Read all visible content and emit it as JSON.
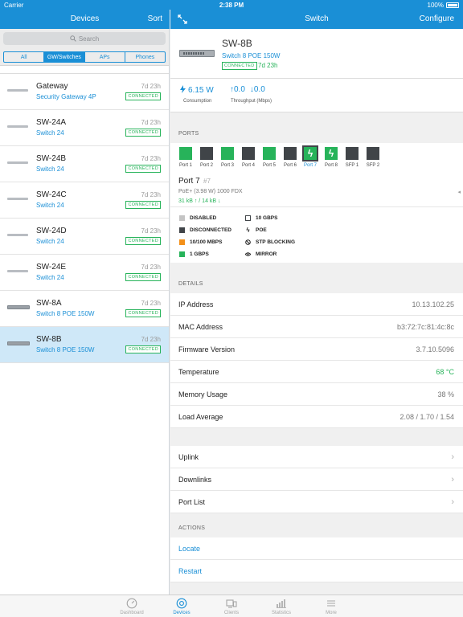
{
  "status": {
    "carrier": "Carrier",
    "time": "2:38 PM",
    "battery": "100%"
  },
  "left_nav": {
    "title": "Devices",
    "sort": "Sort"
  },
  "right_nav": {
    "title": "Switch",
    "configure": "Configure",
    "expand_icon": "expand-icon"
  },
  "search": {
    "placeholder": "Search"
  },
  "filters": [
    {
      "label": "All",
      "active": false
    },
    {
      "label": "GW/Switches",
      "active": true
    },
    {
      "label": "APs",
      "active": false
    },
    {
      "label": "Phones",
      "active": false
    }
  ],
  "devices": [
    {
      "name": "Gateway",
      "model": "Security Gateway 4P",
      "age": "7d 23h",
      "status": "CONNECTED"
    },
    {
      "name": "SW-24A",
      "model": "Switch 24",
      "age": "7d 23h",
      "status": "CONNECTED"
    },
    {
      "name": "SW-24B",
      "model": "Switch 24",
      "age": "7d 23h",
      "status": "CONNECTED"
    },
    {
      "name": "SW-24C",
      "model": "Switch 24",
      "age": "7d 23h",
      "status": "CONNECTED"
    },
    {
      "name": "SW-24D",
      "model": "Switch 24",
      "age": "7d 23h",
      "status": "CONNECTED"
    },
    {
      "name": "SW-24E",
      "model": "Switch 24",
      "age": "7d 23h",
      "status": "CONNECTED"
    },
    {
      "name": "SW-8A",
      "model": "Switch 8 POE 150W",
      "age": "7d 23h",
      "status": "CONNECTED"
    },
    {
      "name": "SW-8B",
      "model": "Switch 8 POE 150W",
      "age": "7d 23h",
      "status": "CONNECTED"
    }
  ],
  "detail": {
    "name": "SW-8B",
    "model": "Switch 8 POE 150W",
    "status": "CONNECTED",
    "age": "7d 23h",
    "consumption_value": "6.15 W",
    "consumption_label": "Consumption",
    "throughput_up": "0.0",
    "throughput_down": "0.0",
    "throughput_label": "Throughput (Mbps)"
  },
  "ports_section": {
    "title": "PORTS",
    "ports": [
      {
        "label": "Port 1",
        "state": "green"
      },
      {
        "label": "Port 2",
        "state": "dark"
      },
      {
        "label": "Port 3",
        "state": "green"
      },
      {
        "label": "Port 4",
        "state": "dark"
      },
      {
        "label": "Port 5",
        "state": "green"
      },
      {
        "label": "Port 6",
        "state": "dark"
      },
      {
        "label": "Port 7",
        "state": "poe",
        "selected": true
      },
      {
        "label": "Port 8",
        "state": "poe"
      },
      {
        "label": "SFP 1",
        "state": "dark"
      },
      {
        "label": "SFP 2",
        "state": "dark"
      }
    ],
    "selected": {
      "title": "Port 7",
      "number": "#7",
      "sub": "PoE+ (3.98 W)   1000 FDX",
      "rates": "31 kB ↑ / 14 kB ↓"
    },
    "legend": {
      "disabled": "DISABLED",
      "disconnected": "DISCONNECTED",
      "mbps": "10/100 MBPS",
      "gbps": "1 GBPS",
      "gbps10": "10 GBPS",
      "poe": "POE",
      "stp": "STP BLOCKING",
      "mirror": "MIRROR"
    }
  },
  "details_section": {
    "title": "DETAILS",
    "rows": [
      {
        "key": "IP Address",
        "value": "10.13.102.25"
      },
      {
        "key": "MAC Address",
        "value": "b3:72:7c:81:4c:8c"
      },
      {
        "key": "Firmware Version",
        "value": "3.7.10.5096"
      },
      {
        "key": "Temperature",
        "value": "68 °C"
      },
      {
        "key": "Memory Usage",
        "value": "38 %"
      },
      {
        "key": "Load Average",
        "value": "2.08 / 1.70 / 1.54"
      }
    ]
  },
  "links": [
    "Uplink",
    "Downlinks",
    "Port List"
  ],
  "actions_section": {
    "title": "ACTIONS",
    "items": [
      "Locate",
      "Restart"
    ]
  },
  "tabs": [
    {
      "label": "Dashboard",
      "icon": "dashboard-icon",
      "active": false
    },
    {
      "label": "Devices",
      "icon": "devices-icon",
      "active": true
    },
    {
      "label": "Clients",
      "icon": "clients-icon",
      "active": false
    },
    {
      "label": "Statistics",
      "icon": "statistics-icon",
      "active": false
    },
    {
      "label": "More",
      "icon": "more-icon",
      "active": false
    }
  ],
  "colors": {
    "accent": "#1a8fd6",
    "connected": "#27b35a",
    "dark_port": "#404448",
    "fast_port": "#f39019"
  }
}
